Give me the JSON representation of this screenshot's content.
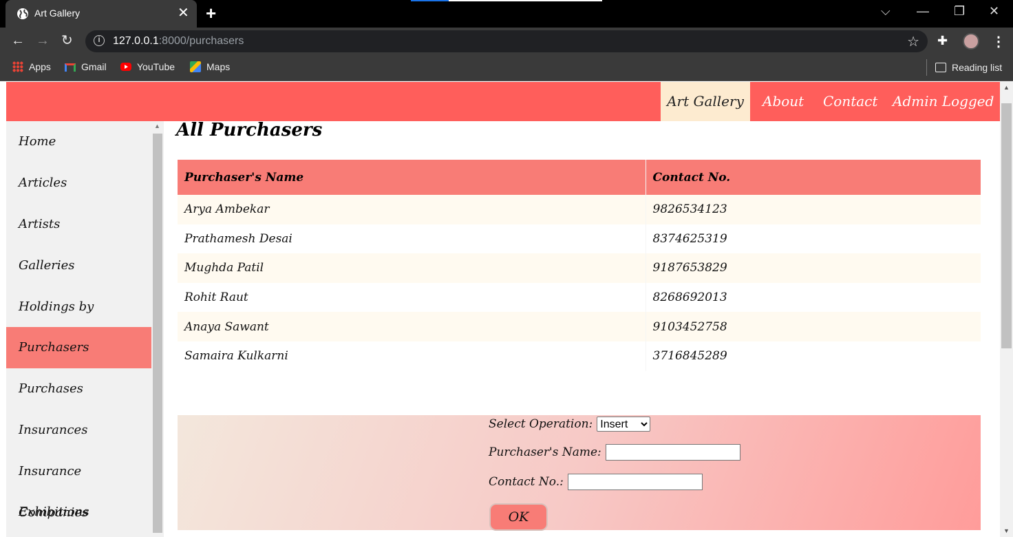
{
  "browser": {
    "tab_title": "Art Gallery",
    "tab_close": "✕",
    "new_tab": "+",
    "url_host": "127.0.0.1",
    "url_rest": ":8000/purchasers",
    "bookmarks": [
      "Apps",
      "Gmail",
      "YouTube",
      "Maps"
    ],
    "reading_list": "Reading list"
  },
  "topnav": {
    "brand": "Art Gallery",
    "items": [
      "About",
      "Contact",
      "Admin Logged In"
    ]
  },
  "sidebar": {
    "items": [
      "Home",
      "Articles",
      "Artists",
      "Galleries",
      "Holdings by Galleries",
      "Purchasers",
      "Purchases",
      "Insurances",
      "Insurance Companies",
      "Exhibitions"
    ],
    "active": "Purchasers"
  },
  "main": {
    "heading": "All Purchasers",
    "table": {
      "headers": [
        "Purchaser's Name",
        "Contact No."
      ],
      "rows": [
        [
          "Arya Ambekar",
          "9826534123"
        ],
        [
          "Prathamesh Desai",
          "8374625319"
        ],
        [
          "Mughda Patil",
          "9187653829"
        ],
        [
          "Rohit Raut",
          "8268692013"
        ],
        [
          "Anaya Sawant",
          "9103452758"
        ],
        [
          "Samaira Kulkarni",
          "3716845289"
        ]
      ]
    },
    "form": {
      "select_label": "Select Operation:",
      "select_value": "Insert",
      "name_label": "Purchaser's Name:",
      "name_value": "",
      "contact_label": "Contact No.:",
      "contact_value": "",
      "ok_label": "OK"
    }
  },
  "colors": {
    "header_bg": "#ff5e5b",
    "active_bg": "#f87c76",
    "brand_bg": "#fdebd0",
    "sidebar_bg": "#f1f1f1"
  }
}
